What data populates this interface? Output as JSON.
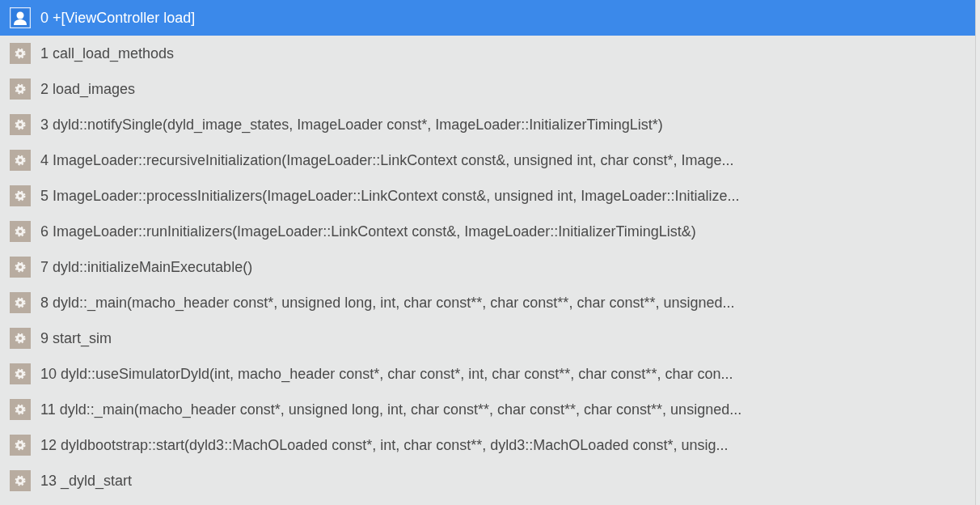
{
  "frames": [
    {
      "label": "0 +[ViewController load]",
      "kind": "user",
      "selected": true
    },
    {
      "label": "1 call_load_methods",
      "kind": "system",
      "selected": false
    },
    {
      "label": "2 load_images",
      "kind": "system",
      "selected": false
    },
    {
      "label": "3 dyld::notifySingle(dyld_image_states, ImageLoader const*, ImageLoader::InitializerTimingList*)",
      "kind": "system",
      "selected": false
    },
    {
      "label": "4 ImageLoader::recursiveInitialization(ImageLoader::LinkContext const&, unsigned int, char const*, Image...",
      "kind": "system",
      "selected": false
    },
    {
      "label": "5 ImageLoader::processInitializers(ImageLoader::LinkContext const&, unsigned int, ImageLoader::Initialize...",
      "kind": "system",
      "selected": false
    },
    {
      "label": "6 ImageLoader::runInitializers(ImageLoader::LinkContext const&, ImageLoader::InitializerTimingList&)",
      "kind": "system",
      "selected": false
    },
    {
      "label": "7 dyld::initializeMainExecutable()",
      "kind": "system",
      "selected": false
    },
    {
      "label": "8 dyld::_main(macho_header const*, unsigned long, int, char const**, char const**, char const**, unsigned...",
      "kind": "system",
      "selected": false
    },
    {
      "label": "9 start_sim",
      "kind": "system",
      "selected": false
    },
    {
      "label": "10 dyld::useSimulatorDyld(int, macho_header const*, char const*, int, char const**, char const**, char con...",
      "kind": "system",
      "selected": false
    },
    {
      "label": "11 dyld::_main(macho_header const*, unsigned long, int, char const**, char const**, char const**, unsigned...",
      "kind": "system",
      "selected": false
    },
    {
      "label": "12 dyldbootstrap::start(dyld3::MachOLoaded const*, int, char const**, dyld3::MachOLoaded const*, unsig...",
      "kind": "system",
      "selected": false
    },
    {
      "label": "13 _dyld_start",
      "kind": "system",
      "selected": false
    }
  ]
}
